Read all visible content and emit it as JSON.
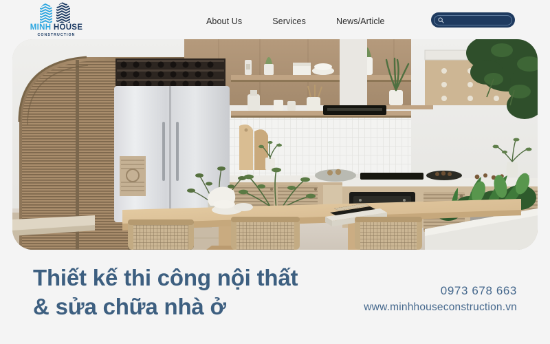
{
  "page": {
    "background_color": "#f4f4f4",
    "accent_navy": "#1e3a5f",
    "accent_light_blue": "#2ca6e0",
    "headline_color": "#3d5f80",
    "contact_color": "#44678c"
  },
  "header": {
    "logo": {
      "mark_icon": "wave-building-logo-icon",
      "word_primary": "MINH",
      "word_secondary": "HOUSE",
      "subtitle": "CONSTRUCTION"
    },
    "nav": [
      {
        "label": "About Us"
      },
      {
        "label": "Services"
      },
      {
        "label": "News/Article"
      }
    ],
    "search": {
      "icon": "search-icon",
      "value": "",
      "placeholder": ""
    }
  },
  "hero": {
    "alt": "Modern minimalist kitchen and dining interior with arched slatted wood wardrobe, stainless steel refrigerator, wooden open shelving, built-in oven, light wood dining table with rattan chairs and indoor plants"
  },
  "footer": {
    "headline_line1": "Thiết kế thi công nội thất",
    "headline_line2": "& sửa chữa nhà ở",
    "phone": "0973 678 663",
    "website": "www.minhhouseconstruction.vn"
  }
}
